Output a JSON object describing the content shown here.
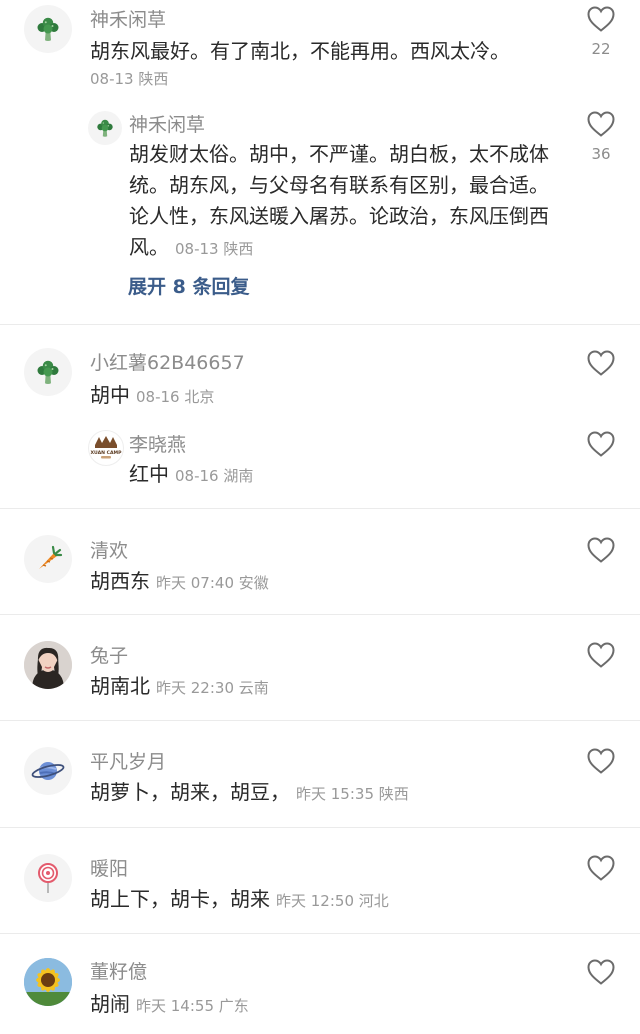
{
  "comments": [
    {
      "user": "神禾闲草",
      "avatar_icon": "broccoli-icon",
      "text": "胡东风最好。有了南北，不能再用。西风太冷。",
      "meta": "08-13 陕西",
      "likes": "22",
      "reply": {
        "user": "神禾闲草",
        "avatar_icon": "broccoli-icon",
        "text": "胡发财太俗。胡中，不严谨。胡白板，太不成体统。胡东风，与父母名有联系有区别，最合适。论人性，东风送暖入屠苏。论政治，东风压倒西风。",
        "meta": "08-13 陕西",
        "likes": "36"
      },
      "expand_label": "展开 8 条回复"
    },
    {
      "user": "小红薯62B46657",
      "avatar_icon": "broccoli-icon",
      "text": "胡中",
      "meta": "08-16 北京",
      "likes": "",
      "reply": {
        "user": "李晓燕",
        "avatar_icon": "brand-logo-avatar",
        "avatar_text": "XUAN CAMP",
        "text": "红中",
        "meta": "08-16 湖南",
        "likes": ""
      }
    },
    {
      "user": "清欢",
      "avatar_icon": "carrot-icon",
      "text": "胡西东",
      "meta": "昨天 07:40 安徽",
      "likes": ""
    },
    {
      "user": "兔子",
      "avatar_icon": "woman-photo-avatar",
      "text": "胡南北",
      "meta": "昨天 22:30 云南",
      "likes": ""
    },
    {
      "user": "平凡岁月",
      "avatar_icon": "planet-icon",
      "text": "胡萝卜，胡来，胡豆，",
      "meta": "昨天 15:35 陕西",
      "likes": ""
    },
    {
      "user": "暖阳",
      "avatar_icon": "lollipop-icon",
      "text": "胡上下，胡卡，胡来",
      "meta": "昨天 12:50 河北",
      "likes": ""
    },
    {
      "user": "董籽億",
      "avatar_icon": "sunflower-photo-avatar",
      "text": "胡闹",
      "meta": "昨天 14:55 广东",
      "likes": ""
    }
  ],
  "colors": {
    "username": "#8c8c8c",
    "text": "#2a2a2a",
    "meta": "#999999",
    "expand": "#3b5c8a",
    "divider": "#ebebeb"
  }
}
